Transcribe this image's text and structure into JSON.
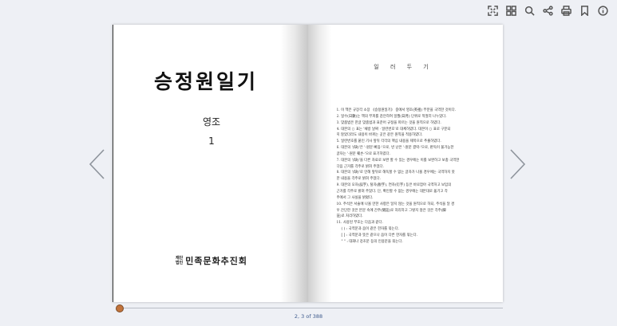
{
  "toolbar": {
    "icons": [
      "fullscreen-icon",
      "grid-icon",
      "search-icon",
      "share-icon",
      "print-icon",
      "bookmark-icon",
      "info-icon"
    ]
  },
  "left_page": {
    "title": "승정원일기",
    "subtitle": "영조",
    "volume": "1",
    "publisher_prefix_1": "재단",
    "publisher_prefix_2": "법인",
    "publisher_name": "민족문화추진회"
  },
  "right_page": {
    "title": "일 러 두 기",
    "notes": [
      "1. 이 책은 규장각 소장 《승정원일기》 중에서 영조(英祖) 부분을 국역한 것이다.",
      "2. 일수(日數)는 책의 부피를 감안하여 일월(日月) 단위로 적절히 나누었다.",
      "3. 맞춤법은 한글 맞춤법과 표준어 규정을 따르는 것을 원칙으로 하였다.",
      "4. 대본의 ○ 표는 '채방 날짜 · 일련번호'로 대체하였다. 대본이 ○ 표로 구분되",
      "   지 않았더라도 내용이 바뀌는 곳은 같은 원칙을 적용하였다.",
      "5. 일련번호를 붙인 기사 앞뒤 각각의 핵심 내용을 제목으로 추출하였다.",
      "6. 대본의 '(缺)'은 '-원문 빠짐-'으로, 빈 난은 '-원문 결락-'으로, 판독이 불가능한",
      "   글자는 '-원문 훼손-'으로 표기하였다.",
      "7. 대본의 '(缺)'을 다른 자료로 보완 할 수 있는 경우에는 이를 보완하고 보충 국역한",
      "   다음 근거를 각주로 밝혀 주었다.",
      "8. 대본의 '(缺)'로 인해 앞뒤로 해독할 수 없는 글자가 나올 경우에는 국역하지 못",
      "   한 내용을 각주로 밝혀 주었다.",
      "9. 대본의 오자(誤字), 탈자(脫字), 연자(衍字) 등은 바로잡아 국역하고 보입의",
      "   근거를 각주로 밝혀 주었다. 단, 확인할 수 없는 경우에는 대본대로 옮기고 각",
      "   주에서 그 사실을 밝혔다.",
      "10. 주석은 서술에 나올 만한 사항은 달지 않는 것을 원칙으로 하되, 주석을 달 경",
      "   우 간단한 것은 본문 속에 간주(間註)로 처리하고 그렇지 않은 것은 각주(脚",
      "   註)로 처리하였다.",
      "11. 사용된 부호는 다음과 같다."
    ],
    "symbols": [
      "( ) : 국역문과 음이 같은 한자를 묶는다.",
      "[ ] : 국역문과 뜻은 같으나 음이 다른 한자를 묶는다.",
      "\" \" : 대화나 강조문 등의 인용문을 묶는다."
    ]
  },
  "pager": {
    "current": "2, 3",
    "of": "of",
    "total": "388"
  },
  "progress": {
    "fraction": 0.005
  }
}
